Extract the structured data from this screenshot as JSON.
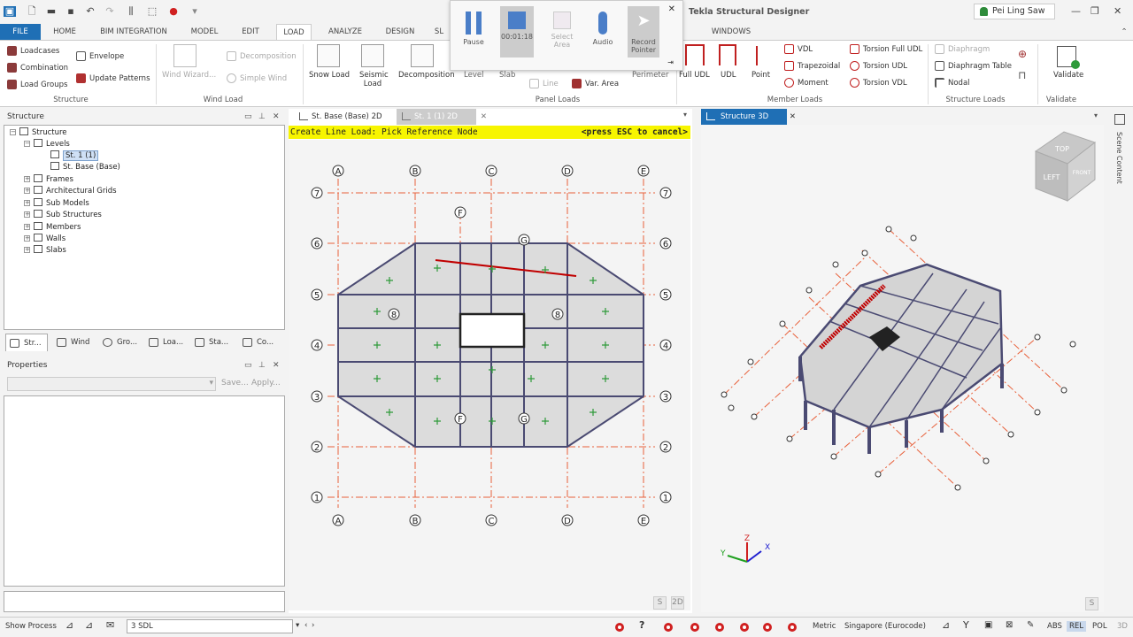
{
  "app": {
    "title": "Tekla Structural Designer",
    "user": "Pei Ling Saw"
  },
  "tabs": [
    "FILE",
    "HOME",
    "BIM INTEGRATION",
    "MODEL",
    "EDIT",
    "LOAD",
    "ANALYZE",
    "DESIGN",
    "SL",
    "WINDOWS"
  ],
  "recorder": {
    "pause": "Pause",
    "time": "00:01:18",
    "select_area": "Select Area",
    "audio": "Audio",
    "record_pointer": "Record Pointer"
  },
  "ribbon": {
    "loadcases": "Loadcases",
    "combination": "Combination",
    "load_groups": "Load Groups",
    "envelope": "Envelope",
    "update_patterns": "Update Patterns",
    "structure_group": "Structure",
    "wind_wizard": "Wind Wizard...",
    "decomposition_dis": "Decomposition",
    "simple_wind": "Simple Wind",
    "wind_load_group": "Wind Load",
    "snow_load": "Snow Load",
    "seismic_load": "Seismic Load",
    "decomposition": "Decomposition",
    "level": "Level",
    "slab": "Slab",
    "line": "Line",
    "var_area": "Var. Area",
    "perimeter": "Perimeter",
    "panel_loads_group": "Panel Loads",
    "full_udl": "Full UDL",
    "udl": "UDL",
    "point": "Point",
    "vdl": "VDL",
    "trapezoidal": "Trapezoidal",
    "moment": "Moment",
    "torsion_full_udl": "Torsion Full UDL",
    "torsion_udl": "Torsion UDL",
    "torsion_vdl": "Torsion VDL",
    "member_loads_group": "Member Loads",
    "diaphragm": "Diaphragm",
    "diaphragm_table": "Diaphragm Table",
    "nodal": "Nodal",
    "structure_loads_group": "Structure Loads",
    "validate": "Validate",
    "validate_group": "Validate"
  },
  "structure_panel": {
    "title": "Structure",
    "tree": [
      "Structure",
      "Levels",
      "St. 1 (1)",
      "St. Base (Base)",
      "Frames",
      "Architectural Grids",
      "Sub Models",
      "Sub Structures",
      "Members",
      "Walls",
      "Slabs"
    ],
    "bottom_tabs": [
      "Str...",
      "Wind",
      "Gro...",
      "Loa...",
      "Sta...",
      "Co..."
    ]
  },
  "properties_panel": {
    "title": "Properties",
    "save": "Save...",
    "apply": "Apply..."
  },
  "doc_tabs": {
    "base2d": "St. Base (Base) 2D",
    "st1_2d": "St. 1 (1) 2D",
    "structure3d": "Structure 3D",
    "scene_content": "Scene Content"
  },
  "command_bar": {
    "prompt": "Create Line Load: Pick Reference Node",
    "cancel": "<press ESC to cancel>"
  },
  "view2d": {
    "col_labels": [
      "A",
      "B",
      "C",
      "D",
      "E"
    ],
    "row_labels": [
      "7",
      "6",
      "5",
      "4",
      "3",
      "2",
      "1"
    ],
    "extra_labels": [
      "F",
      "G",
      "8",
      "8",
      "F",
      "G"
    ],
    "btn_s": "S",
    "btn_2d": "2D"
  },
  "view3d": {
    "cube": [
      "TOP",
      "LEFT",
      "FRONT"
    ],
    "axes": [
      "Z",
      "X",
      "Y"
    ],
    "btn_s": "S"
  },
  "status": {
    "show_process": "Show Process",
    "loadcase": "3 SDL",
    "metric": "Metric",
    "code": "Singapore (Eurocode)",
    "abs": "ABS",
    "rel": "REL",
    "pol": "POL",
    "mode3d": "3D"
  },
  "colors": {
    "accent": "#1f6fb5",
    "command_bg": "#f7f500",
    "grid": "#e8603a",
    "beam": "#4a4a72",
    "load": "#c00000"
  }
}
